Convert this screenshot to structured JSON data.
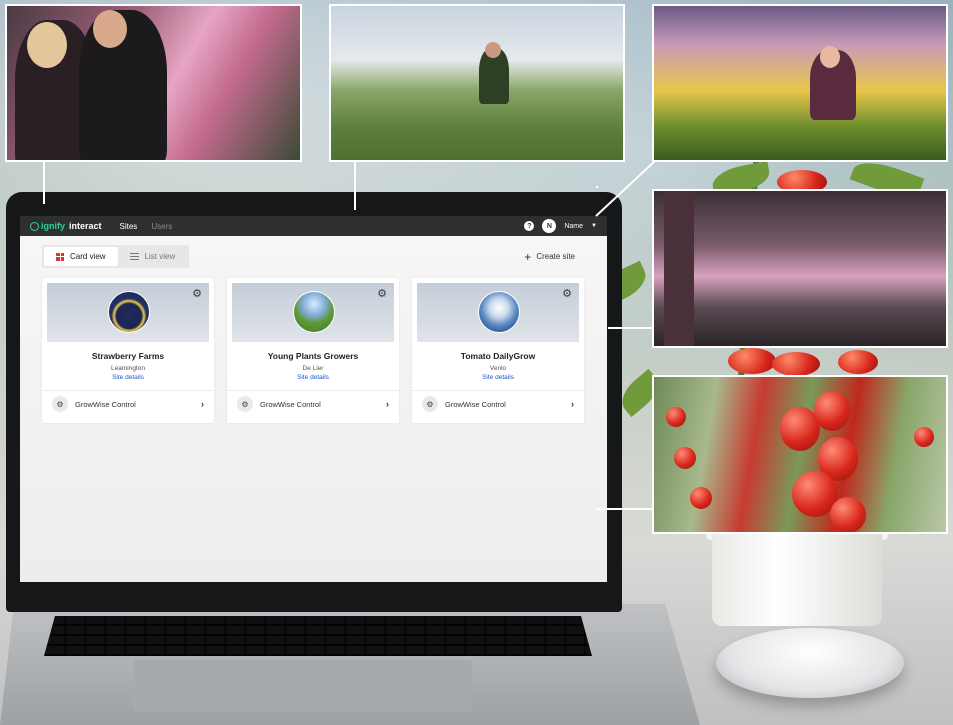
{
  "app": {
    "brand": "ignify",
    "product": "interact",
    "nav": [
      "Sites",
      "Users"
    ],
    "help_label": "?",
    "user_initial": "N",
    "user_name": "Name"
  },
  "toolbar": {
    "card_view_label": "Card view",
    "list_view_label": "List view",
    "create_site_label": "Create site"
  },
  "sites": [
    {
      "title": "Strawberry Farms",
      "location": "Leamington",
      "link": "Site details",
      "app": "GrowWise Control"
    },
    {
      "title": "Young Plants Growers",
      "location": "De Lier",
      "link": "Site details",
      "app": "GrowWise Control"
    },
    {
      "title": "Tomato DailyGrow",
      "location": "Venlo",
      "link": "Site details",
      "app": "GrowWise Control"
    }
  ],
  "icons": {
    "logo": "signify-logo-icon",
    "help": "help-icon",
    "caret": "caret-down-icon",
    "card_view": "grid-icon",
    "list_view": "list-icon",
    "create": "plus-icon",
    "settings": "gear-icon",
    "app": "app-icon",
    "chevron": "chevron-right-icon"
  },
  "colors": {
    "brand_green": "#2bd39a",
    "topbar": "#2d2f31",
    "accent_red": "#e1342d",
    "link_blue": "#1f53d6"
  }
}
